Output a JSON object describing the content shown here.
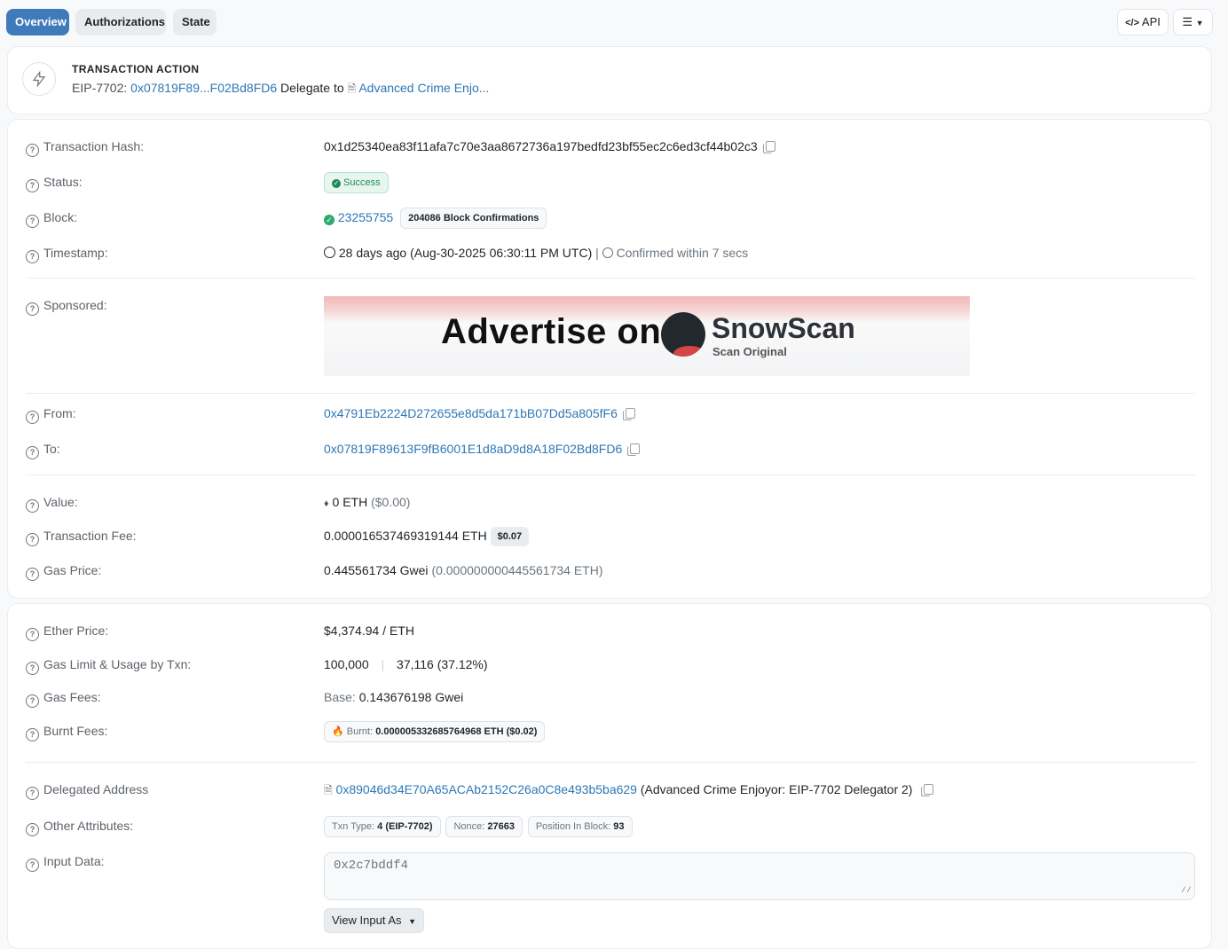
{
  "tabs": [
    {
      "label": "Overview",
      "active": true
    },
    {
      "label": "Authorizations",
      "active": false
    },
    {
      "label": "State",
      "active": false
    }
  ],
  "toolbar": {
    "api_label": "API",
    "api_icon": "code-icon",
    "menu_icon": "list-icon"
  },
  "action": {
    "title": "TRANSACTION ACTION",
    "prefix": "EIP-7702:",
    "address": "0x07819F89...F02Bd8FD6",
    "verb": "Delegate to",
    "target": "Advanced Crime Enjo..."
  },
  "details": {
    "tx_hash": {
      "label": "Transaction Hash:",
      "value": "0x1d25340ea83f11afa7c70e3aa8672736a197bedfd23bf55ec2c6ed3cf44b02c3"
    },
    "status": {
      "label": "Status:",
      "value": "Success"
    },
    "block": {
      "label": "Block:",
      "value": "23255755",
      "confirmations": "204086 Block Confirmations"
    },
    "timestamp": {
      "label": "Timestamp:",
      "value": "28 days ago (Aug-30-2025 06:30:11 PM UTC)",
      "separator": "|",
      "confirmed": "Confirmed within 7 secs"
    },
    "sponsored": {
      "label": "Sponsored:",
      "ad_text": "Advertise on",
      "ad_brand": "SnowScan",
      "ad_sub": "Scan Original"
    },
    "from": {
      "label": "From:",
      "value": "0x4791Eb2224D272655e8d5da171bB07Dd5a805fF6"
    },
    "to": {
      "label": "To:",
      "value": "0x07819F89613F9fB6001E1d8aD9d8A18F02Bd8FD6"
    },
    "value": {
      "label": "Value:",
      "amount": "0 ETH",
      "usd": "($0.00)"
    },
    "fee": {
      "label": "Transaction Fee:",
      "amount": "0.000016537469319144 ETH",
      "usd": "$0.07"
    },
    "gas_price": {
      "label": "Gas Price:",
      "gwei": "0.445561734 Gwei",
      "eth": "(0.000000000445561734 ETH)"
    }
  },
  "more": {
    "ether_price": {
      "label": "Ether Price:",
      "value": "$4,374.94 / ETH"
    },
    "gas_limit": {
      "label": "Gas Limit & Usage by Txn:",
      "limit": "100,000",
      "separator": "|",
      "usage": "37,116 (37.12%)"
    },
    "gas_fees": {
      "label": "Gas Fees:",
      "base_label": "Base:",
      "base_value": "0.143676198 Gwei"
    },
    "burnt": {
      "label": "Burnt Fees:",
      "prefix": "Burnt:",
      "value": "0.000005332685764968 ETH ($0.02)"
    },
    "delegated": {
      "label": "Delegated Address",
      "address": "0x89046d34E70A65ACAb2152C26a0C8e493b5ba629",
      "name": "(Advanced Crime Enjoyor: EIP-7702 Delegator 2)"
    },
    "other": {
      "label": "Other Attributes:",
      "txn_type_label": "Txn Type:",
      "txn_type_value": "4 (EIP-7702)",
      "nonce_label": "Nonce:",
      "nonce_value": "27663",
      "position_label": "Position In Block:",
      "position_value": "93"
    },
    "input": {
      "label": "Input Data:",
      "value": "0x2c7bddf4",
      "view_label": "View Input As"
    }
  }
}
